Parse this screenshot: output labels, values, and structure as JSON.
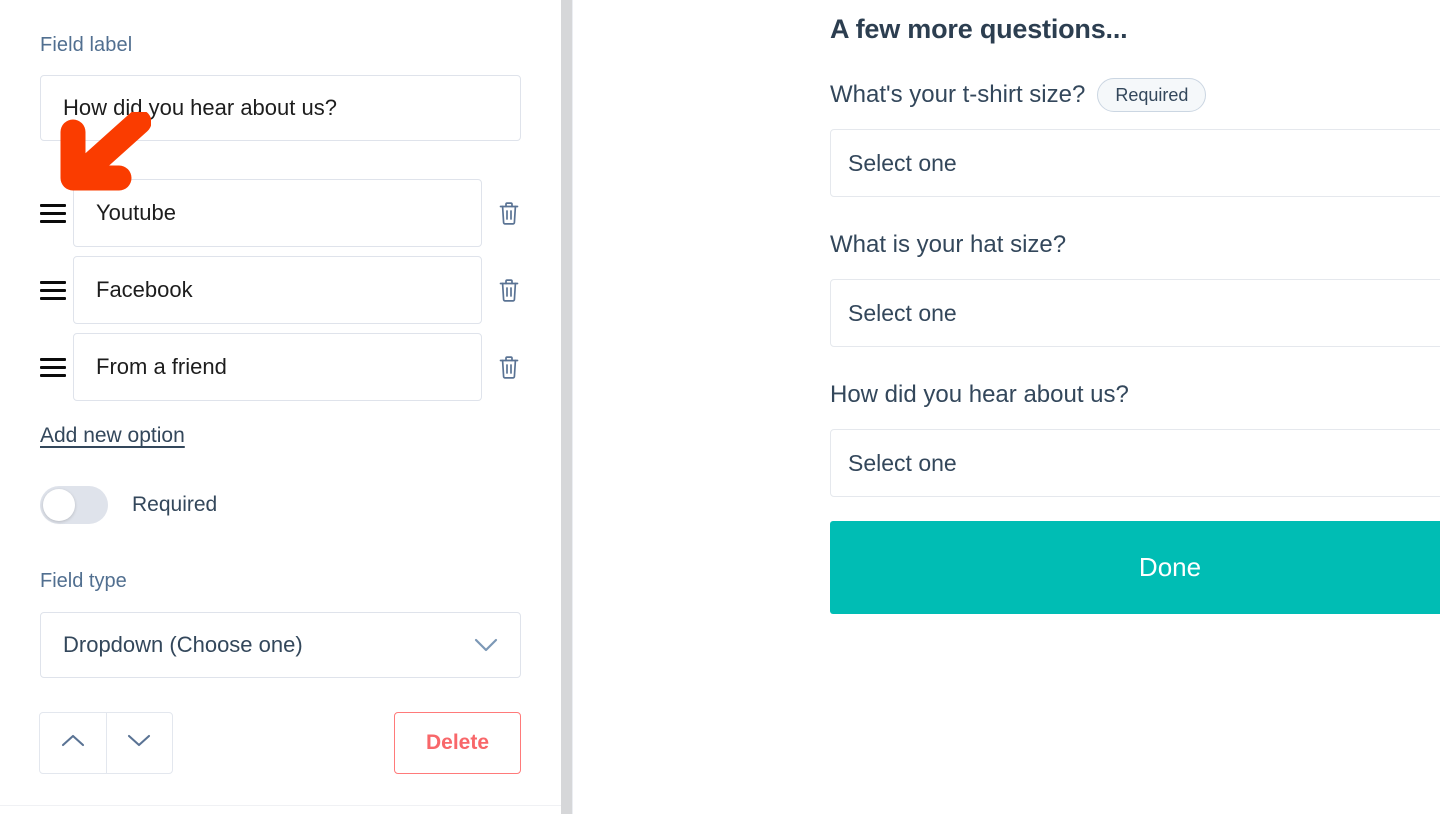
{
  "editor": {
    "field_label_caption": "Field label",
    "field_label_value": "How did you hear about us?",
    "options": [
      {
        "value": "Youtube",
        "drag_icon": "drag-handle-icon",
        "delete_icon": "trash-icon"
      },
      {
        "value": "Facebook",
        "drag_icon": "drag-handle-icon",
        "delete_icon": "trash-icon"
      },
      {
        "value": "From a friend",
        "drag_icon": "drag-handle-icon",
        "delete_icon": "trash-icon"
      }
    ],
    "add_option_link": "Add new option",
    "required_toggle": {
      "label": "Required",
      "state": "off"
    },
    "field_type_caption": "Field type",
    "field_type_value": "Dropdown (Choose one)",
    "field_type_chevron_icon": "chevron-down-icon",
    "move_up_icon": "chevron-up-icon",
    "move_down_icon": "chevron-down-icon",
    "delete_button_label": "Delete"
  },
  "preview": {
    "title": "A few more questions...",
    "questions": [
      {
        "label": "What's your t-shirt size?",
        "required_badge": "Required",
        "placeholder": "Select one"
      },
      {
        "label": "What is your hat size?",
        "required_badge": "",
        "placeholder": "Select one"
      },
      {
        "label": "How did you hear about us?",
        "required_badge": "",
        "placeholder": "Select one"
      }
    ],
    "submit_label": "Done"
  },
  "annotation": {
    "arrow_icon": "arrow-down-left-icon",
    "arrow_color": "#fa3c00"
  },
  "colors": {
    "accent_teal": "#00bdb4",
    "delete_red": "#f8676a",
    "muted_text": "#516f90",
    "body_text": "#33475b",
    "border": "#dfe3eb"
  }
}
